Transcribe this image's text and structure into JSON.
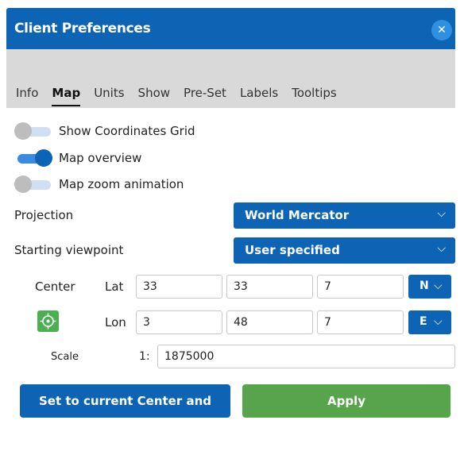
{
  "dialog": {
    "title": "Client Preferences",
    "close_glyph": "✕"
  },
  "tabs": [
    {
      "label": "Info",
      "active": false
    },
    {
      "label": "Map",
      "active": true
    },
    {
      "label": "Units",
      "active": false
    },
    {
      "label": "Show",
      "active": false
    },
    {
      "label": "Pre-Set",
      "active": false
    },
    {
      "label": "Labels",
      "active": false
    },
    {
      "label": "Tooltips",
      "active": false
    }
  ],
  "toggles": [
    {
      "label": "Show Coordinates Grid",
      "on": false
    },
    {
      "label": "Map overview",
      "on": true
    },
    {
      "label": "Map zoom animation",
      "on": false
    }
  ],
  "projection": {
    "label": "Projection",
    "value": "World Mercator"
  },
  "viewpoint": {
    "label": "Starting viewpoint",
    "value": "User specified"
  },
  "center": {
    "label": "Center",
    "lat": {
      "label": "Lat",
      "deg": "33",
      "min": "33",
      "sec": "7",
      "hemisphere": "N"
    },
    "lon": {
      "label": "Lon",
      "deg": "3",
      "min": "48",
      "sec": "7",
      "hemisphere": "E"
    }
  },
  "scale": {
    "label": "Scale",
    "prefix": "1:",
    "value": "1875000"
  },
  "buttons": {
    "set_current": "Set to current Center and Scale",
    "apply": "Apply"
  },
  "glyphs": {
    "chevron": "⌵"
  },
  "colors": {
    "primary": "#0d64b4",
    "apply": "#56a54a",
    "header_gray": "#d9d9d9"
  }
}
